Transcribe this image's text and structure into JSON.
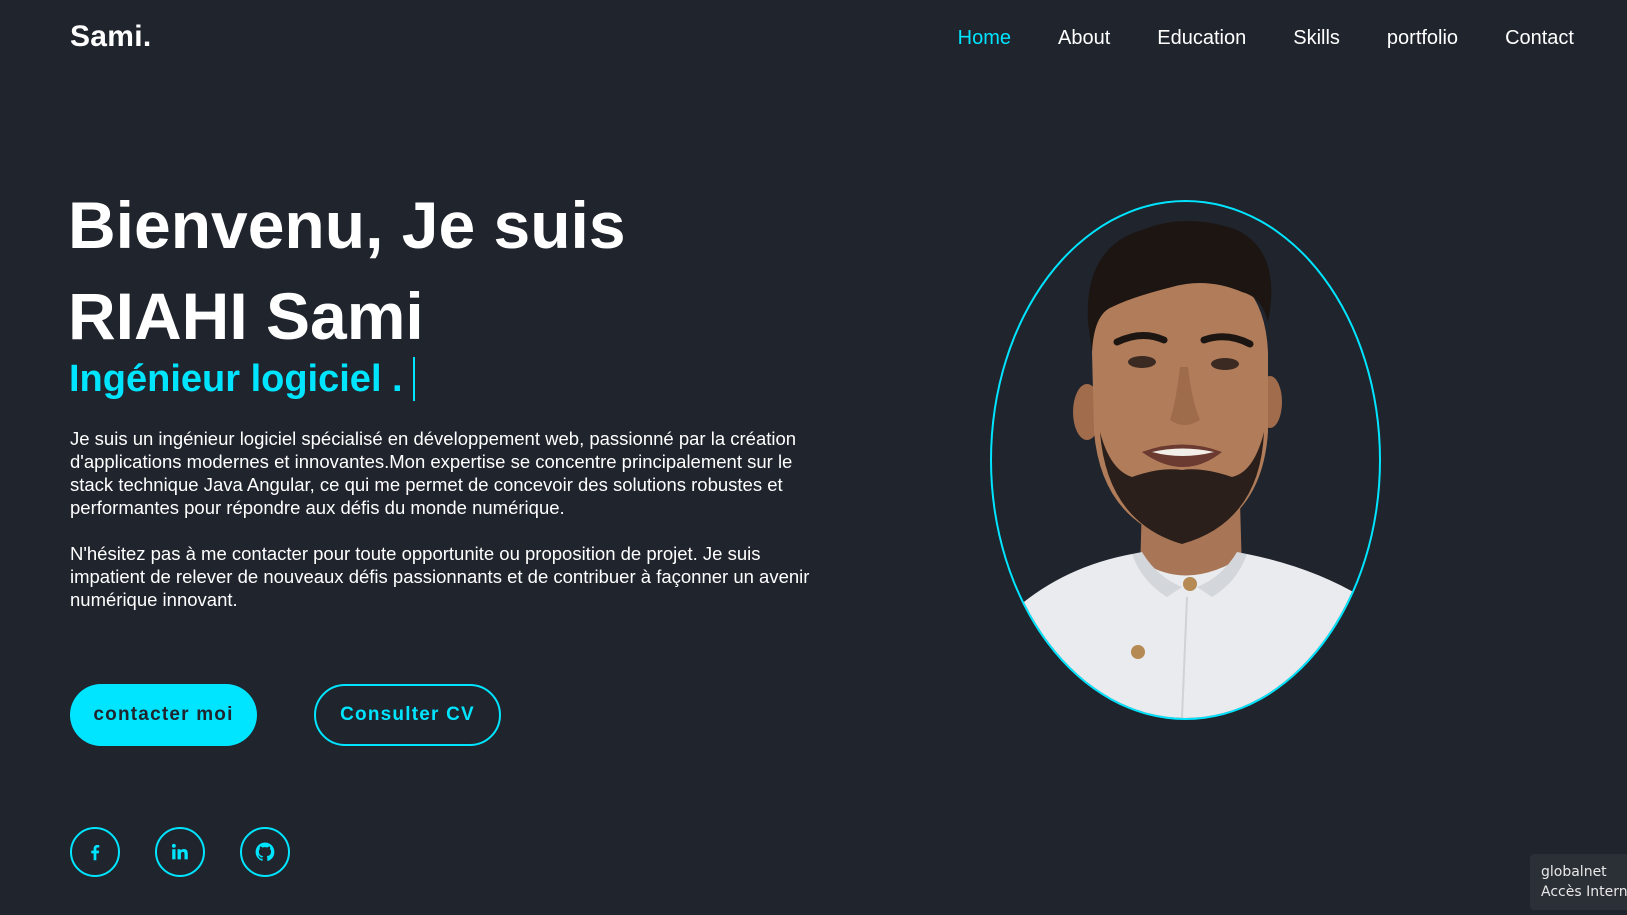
{
  "header": {
    "logo": "Sami.",
    "nav": [
      {
        "label": "Home",
        "active": true
      },
      {
        "label": "About",
        "active": false
      },
      {
        "label": "Education",
        "active": false
      },
      {
        "label": "Skills",
        "active": false
      },
      {
        "label": "portfolio",
        "active": false
      },
      {
        "label": "Contact",
        "active": false
      }
    ]
  },
  "hero": {
    "title_line1": "Bienvenu, Je suis",
    "title_line2": "RIAHI Sami",
    "role": "Ingénieur logiciel .",
    "paragraph1": "Je suis un ingénieur logiciel spécialisé en développement web, passionné par la création d'applications modernes et innovantes.Mon expertise se concentre principalement sur le stack technique Java Angular, ce qui me permet de concevoir des solutions robustes et performantes pour répondre aux défis du monde numérique.",
    "paragraph2": "N'hésitez pas à me contacter pour toute opportunite ou proposition de projet. Je suis impatient de relever de nouveaux défis passionnants et de contribuer à façonner un avenir numérique innovant.",
    "btn_contact": "contacter moi",
    "btn_cv": "Consulter CV"
  },
  "socials": [
    {
      "icon": "facebook-icon"
    },
    {
      "icon": "linkedin-icon"
    },
    {
      "icon": "github-icon"
    }
  ],
  "portrait": {
    "icon": "profile-photo"
  },
  "toast": {
    "line1": "globalnet",
    "line2": "Accès Interne"
  },
  "colors": {
    "background": "#1f242d",
    "accent": "#00e5ff",
    "text": "#ffffff"
  }
}
